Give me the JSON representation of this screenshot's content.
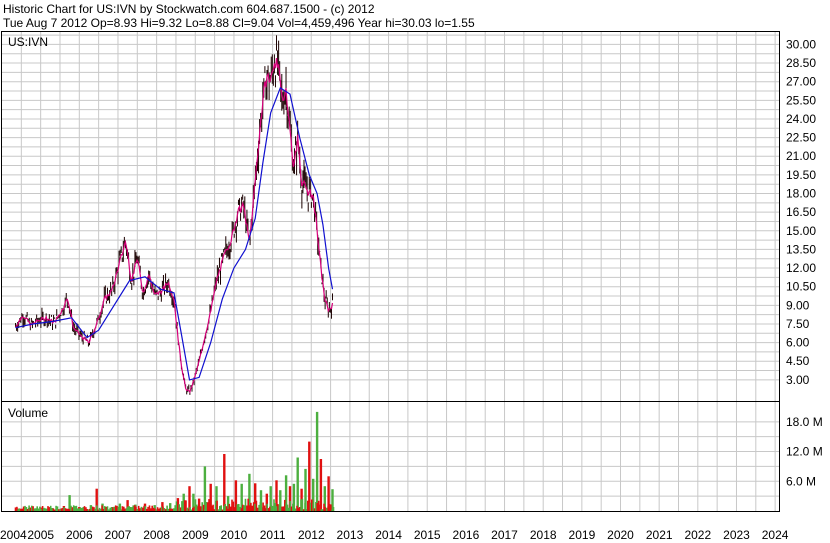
{
  "header": {
    "line1": "Historic Chart for US:IVN by Stockwatch.com 604.687.1500 - (c) 2012",
    "line2": "Tue Aug  7 2012  Op=8.93  Hi=9.32  Lo=8.88  Cl=9.04  Vol=4,459,496  Year hi=30.03  lo=1.55"
  },
  "colors": {
    "grid": "#c8c8c8",
    "candle": "#1a0000",
    "ma_fast": "#d6007a",
    "ma_slow": "#1010d0",
    "vol_up": "#4caf3f",
    "vol_down": "#e01010"
  },
  "chart_data": [
    {
      "type": "line",
      "panel_label": "US:IVN",
      "x_unit": "year",
      "y_ticks": [
        3.0,
        4.5,
        6.0,
        7.5,
        9.0,
        10.5,
        12.0,
        13.5,
        15.0,
        16.5,
        18.0,
        19.5,
        21.0,
        22.5,
        24.0,
        25.5,
        27.0,
        28.5,
        30.0
      ],
      "ylim": [
        1.3,
        31.0
      ],
      "xlim": [
        2004.0,
        2024.1
      ],
      "grid": true,
      "price_points": [
        [
          2004.35,
          7.3
        ],
        [
          2004.55,
          8.2
        ],
        [
          2004.75,
          7.4
        ],
        [
          2004.95,
          7.8
        ],
        [
          2005.15,
          8.0
        ],
        [
          2005.35,
          7.6
        ],
        [
          2005.55,
          8.6
        ],
        [
          2005.7,
          9.6
        ],
        [
          2005.85,
          7.2
        ],
        [
          2006.05,
          6.5
        ],
        [
          2006.25,
          6.0
        ],
        [
          2006.45,
          7.5
        ],
        [
          2006.65,
          9.5
        ],
        [
          2006.85,
          10.2
        ],
        [
          2007.05,
          12.5
        ],
        [
          2007.2,
          14.2
        ],
        [
          2007.35,
          11.0
        ],
        [
          2007.5,
          12.8
        ],
        [
          2007.65,
          10.0
        ],
        [
          2007.8,
          11.5
        ],
        [
          2007.95,
          9.8
        ],
        [
          2008.15,
          10.2
        ],
        [
          2008.3,
          10.9
        ],
        [
          2008.45,
          9.5
        ],
        [
          2008.55,
          6.5
        ],
        [
          2008.65,
          4.0
        ],
        [
          2008.75,
          2.3
        ],
        [
          2008.85,
          2.0
        ],
        [
          2008.95,
          2.8
        ],
        [
          2009.1,
          4.5
        ],
        [
          2009.25,
          6.5
        ],
        [
          2009.4,
          8.5
        ],
        [
          2009.55,
          11.0
        ],
        [
          2009.75,
          13.0
        ],
        [
          2009.95,
          14.5
        ],
        [
          2010.1,
          16.5
        ],
        [
          2010.25,
          17.0
        ],
        [
          2010.4,
          14.0
        ],
        [
          2010.55,
          19.0
        ],
        [
          2010.65,
          22.5
        ],
        [
          2010.75,
          25.5
        ],
        [
          2010.85,
          27.5
        ],
        [
          2010.95,
          27.0
        ],
        [
          2011.05,
          28.8
        ],
        [
          2011.15,
          28.0
        ],
        [
          2011.25,
          25.5
        ],
        [
          2011.35,
          26.5
        ],
        [
          2011.45,
          23.0
        ],
        [
          2011.55,
          20.0
        ],
        [
          2011.65,
          22.5
        ],
        [
          2011.75,
          19.0
        ],
        [
          2011.85,
          18.5
        ],
        [
          2011.95,
          18.0
        ],
        [
          2012.05,
          17.8
        ],
        [
          2012.15,
          15.0
        ],
        [
          2012.25,
          12.0
        ],
        [
          2012.35,
          9.5
        ],
        [
          2012.45,
          8.6
        ],
        [
          2012.55,
          9.04
        ]
      ],
      "ma_slow_points": [
        [
          2004.35,
          7.2
        ],
        [
          2004.8,
          7.5
        ],
        [
          2005.3,
          7.7
        ],
        [
          2005.8,
          8.0
        ],
        [
          2006.2,
          6.4
        ],
        [
          2006.5,
          7.0
        ],
        [
          2006.9,
          9.0
        ],
        [
          2007.3,
          11.0
        ],
        [
          2007.7,
          11.3
        ],
        [
          2008.1,
          10.3
        ],
        [
          2008.45,
          10.0
        ],
        [
          2008.65,
          6.5
        ],
        [
          2008.85,
          3.0
        ],
        [
          2009.1,
          3.2
        ],
        [
          2009.4,
          6.0
        ],
        [
          2009.7,
          9.5
        ],
        [
          2010.0,
          12.0
        ],
        [
          2010.3,
          13.5
        ],
        [
          2010.55,
          16.0
        ],
        [
          2010.75,
          20.5
        ],
        [
          2010.95,
          24.5
        ],
        [
          2011.2,
          26.5
        ],
        [
          2011.45,
          26.0
        ],
        [
          2011.7,
          22.5
        ],
        [
          2011.95,
          19.5
        ],
        [
          2012.15,
          18.0
        ],
        [
          2012.3,
          15.5
        ],
        [
          2012.45,
          12.0
        ],
        [
          2012.55,
          10.3
        ]
      ],
      "volume": {
        "label": "Volume",
        "y_ticks": [
          6.0,
          12.0,
          18.0
        ],
        "y_tick_labels": [
          "6.0 M",
          "12.0 M",
          "18.0 M"
        ],
        "ylim": [
          0,
          22.0
        ],
        "bars": [
          [
            2004.4,
            0.5,
            "down"
          ],
          [
            2004.7,
            0.6,
            "up"
          ],
          [
            2005.0,
            0.7,
            "down"
          ],
          [
            2005.3,
            0.6,
            "up"
          ],
          [
            2005.6,
            1.0,
            "down"
          ],
          [
            2005.75,
            3.2,
            "up"
          ],
          [
            2006.0,
            0.8,
            "down"
          ],
          [
            2006.3,
            1.2,
            "up"
          ],
          [
            2006.45,
            4.5,
            "down"
          ],
          [
            2006.6,
            1.5,
            "up"
          ],
          [
            2006.85,
            0.8,
            "down"
          ],
          [
            2007.05,
            1.5,
            "up"
          ],
          [
            2007.25,
            2.2,
            "down"
          ],
          [
            2007.45,
            1.3,
            "up"
          ],
          [
            2007.7,
            1.5,
            "down"
          ],
          [
            2007.95,
            1.2,
            "up"
          ],
          [
            2008.15,
            1.8,
            "down"
          ],
          [
            2008.35,
            1.6,
            "up"
          ],
          [
            2008.55,
            2.6,
            "down"
          ],
          [
            2008.7,
            3.5,
            "up"
          ],
          [
            2008.85,
            5.0,
            "down"
          ],
          [
            2008.95,
            3.5,
            "up"
          ],
          [
            2009.1,
            2.5,
            "down"
          ],
          [
            2009.25,
            9.0,
            "up"
          ],
          [
            2009.4,
            5.5,
            "down"
          ],
          [
            2009.55,
            5.0,
            "up"
          ],
          [
            2009.75,
            11.5,
            "down"
          ],
          [
            2009.85,
            3.0,
            "up"
          ],
          [
            2010.05,
            6.2,
            "down"
          ],
          [
            2010.2,
            5.5,
            "up"
          ],
          [
            2010.4,
            7.5,
            "up"
          ],
          [
            2010.55,
            5.6,
            "down"
          ],
          [
            2010.7,
            4.2,
            "up"
          ],
          [
            2010.85,
            3.5,
            "down"
          ],
          [
            2010.95,
            5.0,
            "up"
          ],
          [
            2011.1,
            6.2,
            "down"
          ],
          [
            2011.2,
            4.2,
            "up"
          ],
          [
            2011.35,
            7.2,
            "up"
          ],
          [
            2011.45,
            5.0,
            "down"
          ],
          [
            2011.55,
            5.5,
            "up"
          ],
          [
            2011.65,
            10.8,
            "up"
          ],
          [
            2011.75,
            4.5,
            "down"
          ],
          [
            2011.85,
            8.5,
            "up"
          ],
          [
            2011.95,
            14.0,
            "down"
          ],
          [
            2012.05,
            6.5,
            "up"
          ],
          [
            2012.15,
            20.0,
            "up"
          ],
          [
            2012.25,
            10.5,
            "down"
          ],
          [
            2012.35,
            5.0,
            "up"
          ],
          [
            2012.45,
            7.0,
            "down"
          ],
          [
            2012.55,
            4.4,
            "up"
          ]
        ]
      },
      "x_tick_labels": [
        "2004",
        "2005",
        "2006",
        "2007",
        "2008",
        "2009",
        "2010",
        "2011",
        "2012",
        "2013",
        "2014",
        "2015",
        "2016",
        "2017",
        "2018",
        "2019",
        "2020",
        "2021",
        "2022",
        "2023",
        "2024"
      ]
    }
  ]
}
